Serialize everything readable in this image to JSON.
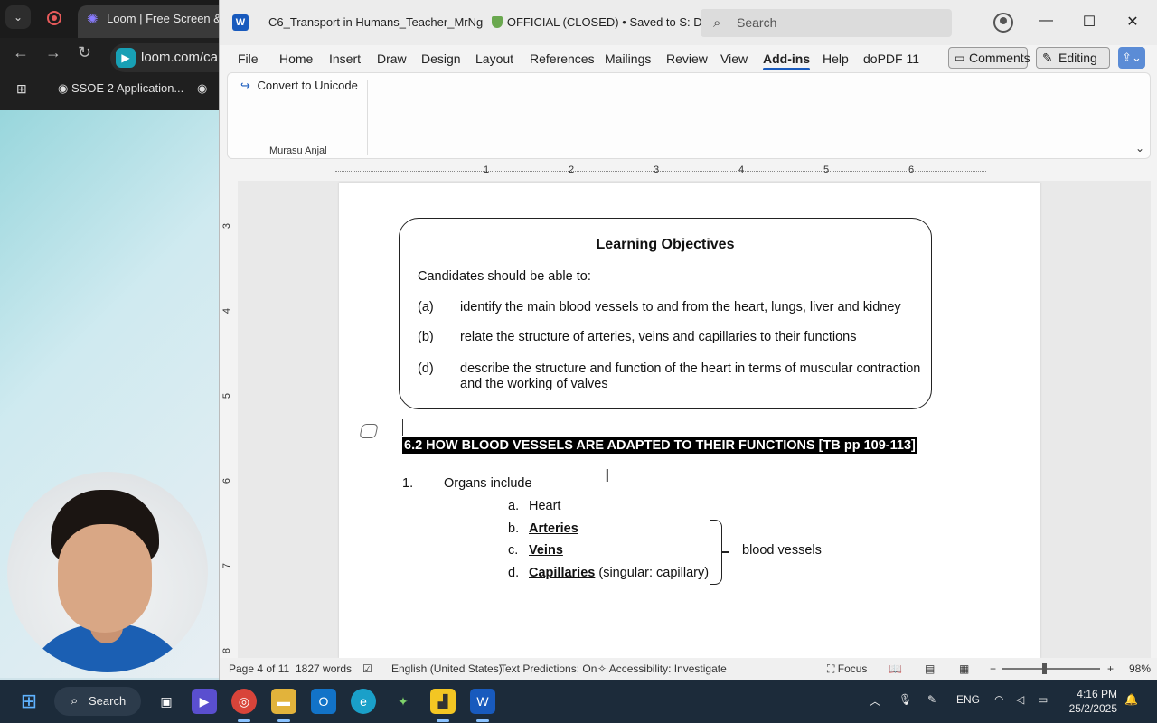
{
  "browser": {
    "tab_title": "Loom | Free Screen & V",
    "omnibox_text": "loom.com/ca",
    "bookmark_1": "SSOE 2 Application..."
  },
  "word": {
    "doc_title": "C6_Transport in Humans_Teacher_MrNg",
    "classification": "OFFICIAL (CLOSED)",
    "save_status": "Saved to S: Drive",
    "search_placeholder": "Search",
    "menu": [
      "File",
      "Home",
      "Insert",
      "Draw",
      "Design",
      "Layout",
      "References",
      "Mailings",
      "Review",
      "View",
      "Add-ins",
      "Help",
      "doPDF 11"
    ],
    "active_tab": "Add-ins",
    "comments_label": "Comments",
    "editing_label": "Editing",
    "ribbon": {
      "button_label": "Convert to Unicode",
      "group_label": "Murasu Anjal"
    },
    "ruler": [
      "1",
      "2",
      "3",
      "4",
      "5",
      "6"
    ],
    "vruler": [
      "3",
      "4",
      "5",
      "6",
      "7",
      "8"
    ],
    "status": {
      "page": "Page 4 of 11",
      "words": "1827 words",
      "language": "English (United States)",
      "predictions": "Text Predictions: On",
      "accessibility": "Accessibility: Investigate",
      "focus": "Focus",
      "zoom": "98%"
    }
  },
  "document": {
    "objectives_title": "Learning Objectives",
    "objectives_intro": "Candidates should be able to:",
    "objectives": [
      {
        "label": "(a)",
        "text": "identify the main blood vessels to and from the heart, lungs, liver and kidney"
      },
      {
        "label": "(b)",
        "text": "relate the structure of arteries, veins and capillaries to their functions"
      },
      {
        "label": "(d)",
        "text": "describe the structure and function of the heart in terms of muscular contraction and the working of valves"
      }
    ],
    "heading": "6.2 HOW BLOOD VESSELS ARE ADAPTED TO THEIR FUNCTIONS [TB pp 109-113]",
    "point_number": "1.",
    "point_text": "Organs include",
    "organs": [
      {
        "letter": "a.",
        "name": "Heart",
        "bold": false,
        "note": ""
      },
      {
        "letter": "b.",
        "name": "Arteries",
        "bold": true,
        "note": ""
      },
      {
        "letter": "c.",
        "name": "Veins",
        "bold": true,
        "note": ""
      },
      {
        "letter": "d.",
        "name": "Capillaries",
        "bold": true,
        "note": "(singular: capillary)"
      }
    ],
    "brace_label": "blood vessels"
  },
  "taskbar": {
    "search_label": "Search",
    "language": "ENG",
    "time": "4:16 PM",
    "date": "25/2/2025"
  }
}
